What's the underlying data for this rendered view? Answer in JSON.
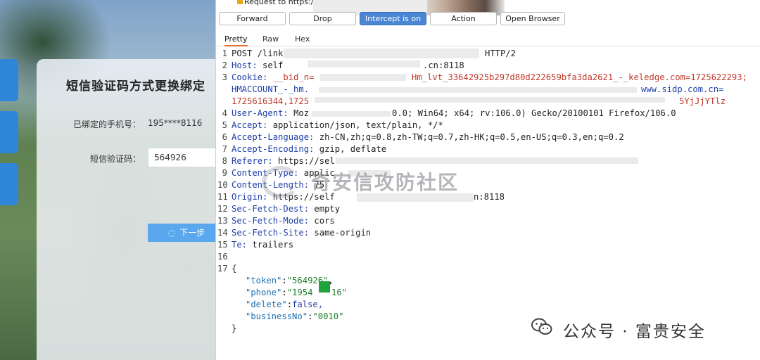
{
  "left_page": {
    "title": "短信验证码方式更换绑定",
    "phone_label": "已绑定的手机号：",
    "phone_value": "195****8116",
    "code_label": "短信验证码：",
    "code_value": "564926",
    "next_label": "下一步"
  },
  "burp": {
    "request_prefix": "Request to https:/",
    "buttons": {
      "forward": "Forward",
      "drop": "Drop",
      "intercept": "Intercept is on",
      "action": "Action",
      "open_browser": "Open Browser"
    },
    "tabs": {
      "pretty": "Pretty",
      "raw": "Raw",
      "hex": "Hex"
    },
    "lines": {
      "l1a": "POST /link",
      "l1b": "HTTP/2",
      "l2k": "Host: ",
      "l2v": "self",
      "l2v2": ".cn:8118",
      "l3k": "Cookie: ",
      "l3v": "__bid_n=",
      "l3v2": "Hm_lvt_33642925b297d80d222659bfa3da2621_-_keledge.com=1725622293;",
      "l3c": "HMACCOUNT_-_hm.",
      "l3c2": "www.sidp.com.cn=",
      "l3d": "1725616344,1725",
      "l3d2": "5YjJjYTlz",
      "l4k": "User-Agent: ",
      "l4v": "Moz",
      "l4v2": "0.0; Win64; x64; rv:106.0) Gecko/20100101 Firefox/106.0",
      "l5k": "Accept: ",
      "l5v": "application/json, text/plain, */*",
      "l6k": "Accept-Language: ",
      "l6v": "zh-CN,zh;q=0.8,zh-TW;q=0.7,zh-HK;q=0.5,en-US;q=0.3,en;q=0.2",
      "l7k": "Accept-Encoding: ",
      "l7v": "gzip, deflate",
      "l8k": "Referer: ",
      "l8v": "https://sel",
      "l9k": "Content-Type: ",
      "l9v": "applic",
      "l10k": "Content-Length: ",
      "l10v": "75",
      "l11k": "Origin: ",
      "l11v": "https://self",
      "l11v2": "n:8118",
      "l12k": "Sec-Fetch-Dest: ",
      "l12v": "empty",
      "l13k": "Sec-Fetch-Mode: ",
      "l13v": "cors",
      "l14k": "Sec-Fetch-Site: ",
      "l14v": "same-origin",
      "l15k": "Te: ",
      "l15v": "trailers",
      "brace_open": "{",
      "j1k": "\"token\"",
      "j1v": "\"564926\"",
      "j2k": "\"phone\"",
      "j2v": "\"1954",
      "j2v2": "16\"",
      "j3k": "\"delete\"",
      "j3v": "false,",
      "j4k": "\"businessNo\"",
      "j4v": "\"0010\"",
      "brace_close": "}"
    }
  },
  "watermarks": {
    "center": "奇安信攻防社区",
    "brand": "公众号 · 富贵安全"
  },
  "colors": {
    "accent": "#4a86d4",
    "cookie": "#c0392b",
    "header_key": "#1f3fa8",
    "json_string": "#1e7d2c"
  }
}
